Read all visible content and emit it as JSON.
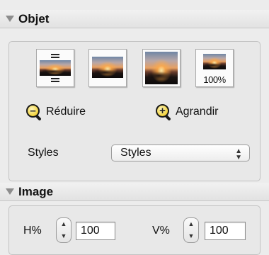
{
  "objet": {
    "title": "Objet",
    "thumbs": [
      {
        "name": "fit-height-icon"
      },
      {
        "name": "fit-width-icon"
      },
      {
        "name": "fill-icon"
      },
      {
        "name": "actual-size-icon",
        "caption": "100%"
      }
    ],
    "reduce_label": "Réduire",
    "enlarge_label": "Agrandir",
    "styles_label": "Styles",
    "styles_value": "Styles"
  },
  "image": {
    "title": "Image",
    "h_label": "H%",
    "h_value": "100",
    "v_label": "V%",
    "v_value": "100"
  }
}
